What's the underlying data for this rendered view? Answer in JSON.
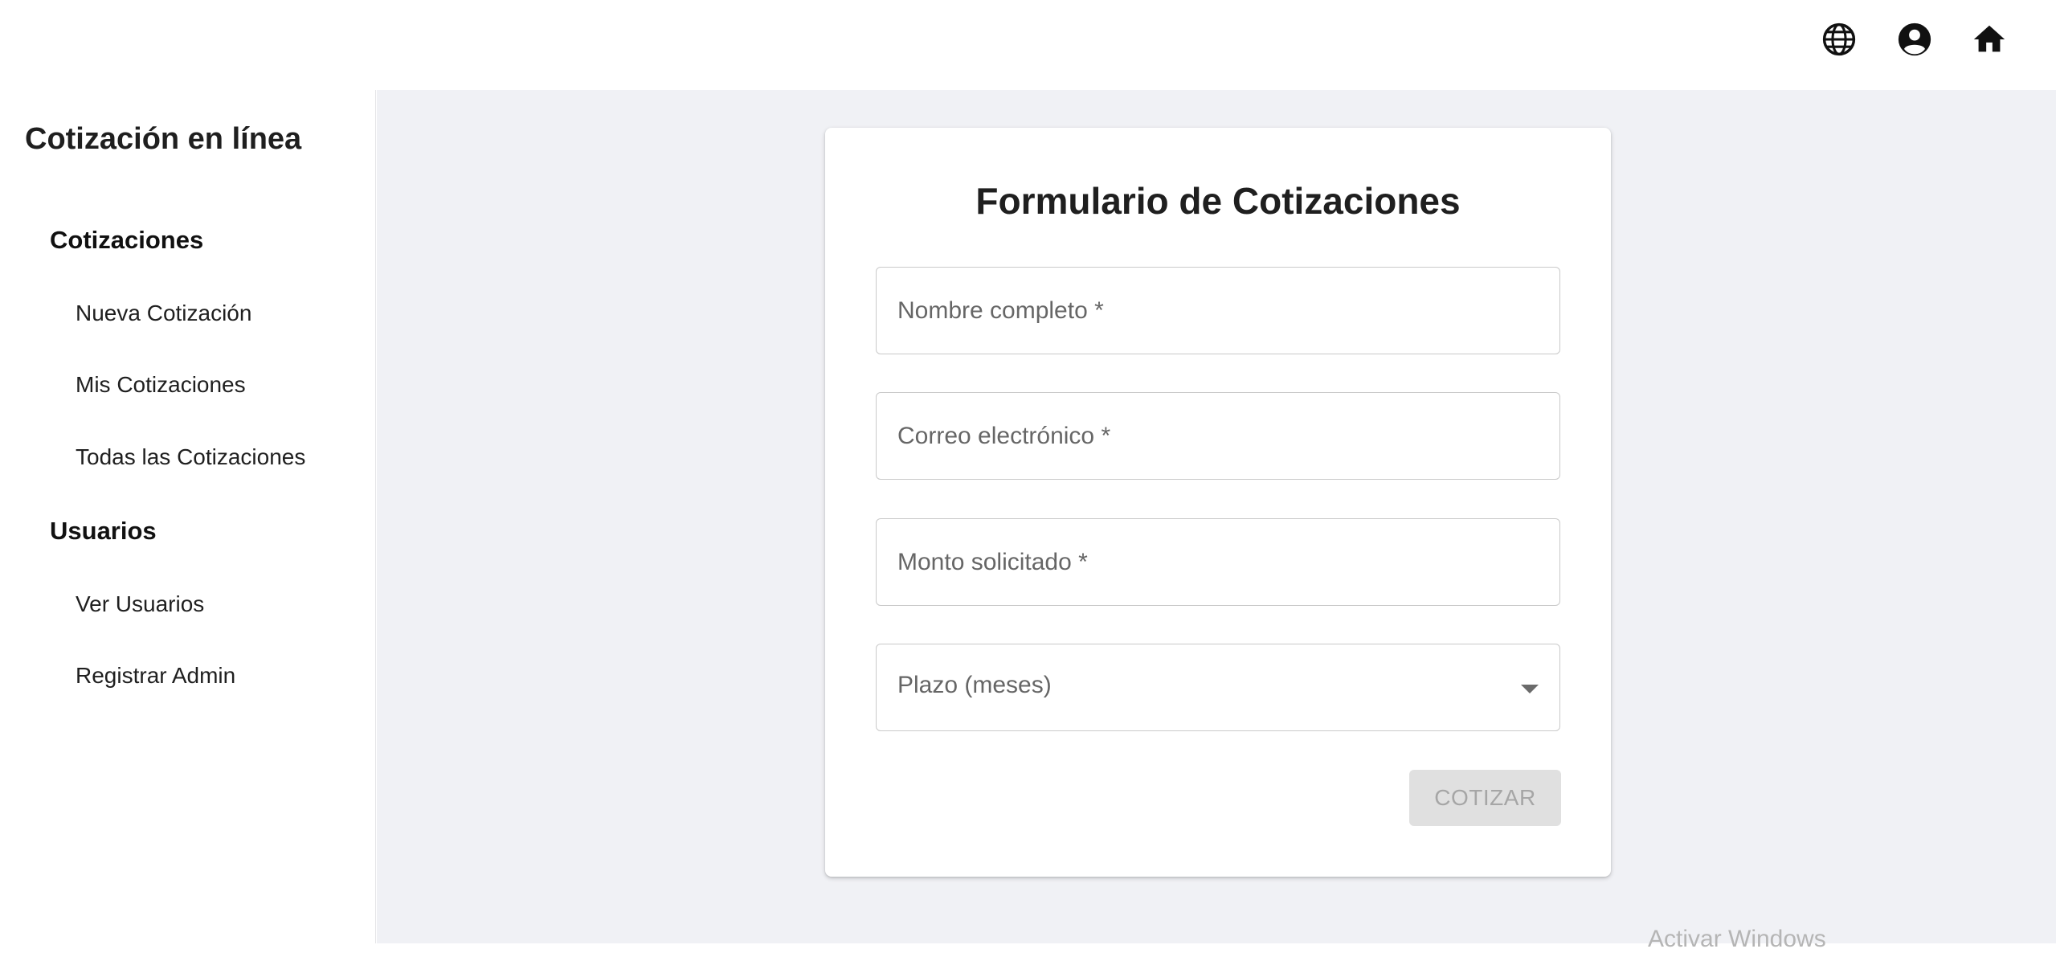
{
  "header": {
    "icons": [
      "globe-icon",
      "account-circle-icon",
      "home-icon"
    ]
  },
  "sidebar": {
    "title": "Cotización en línea",
    "sections": [
      {
        "title": "Cotizaciones",
        "items": [
          "Nueva Cotización",
          "Mis Cotizaciones",
          "Todas las Cotizaciones"
        ]
      },
      {
        "title": "Usuarios",
        "items": [
          "Ver Usuarios",
          "Registrar Admin"
        ]
      }
    ]
  },
  "form": {
    "title": "Formulario de Cotizaciones",
    "fields": {
      "name_placeholder": "Nombre completo *",
      "email_placeholder": "Correo electrónico *",
      "amount_placeholder": "Monto solicitado *",
      "term_label": "Plazo (meses)"
    },
    "submit_label": "COTIZAR"
  },
  "watermark": "Activar Windows",
  "colors": {
    "main_background": "#f0f1f5",
    "disabled_button": "#e0e0e0",
    "disabled_text": "#a6a6a6"
  }
}
